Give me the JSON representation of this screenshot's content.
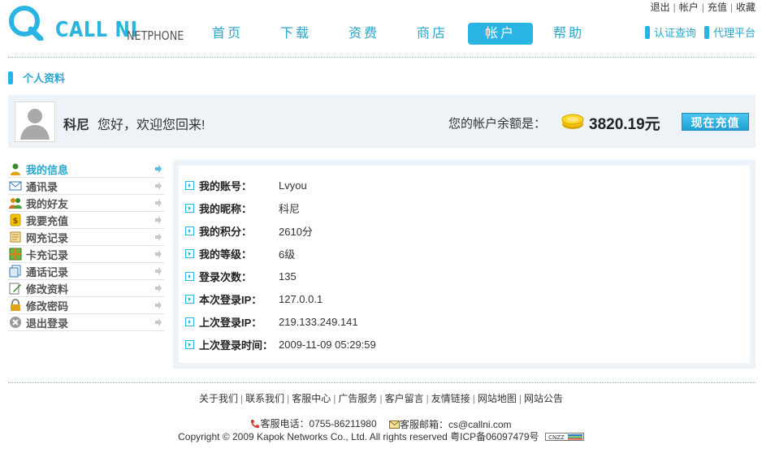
{
  "brand": {
    "logo_text": "CALL NI",
    "logo_sub": "NETPHONE",
    "color_accent": "#2ab4e4"
  },
  "top_links": [
    "退出",
    "帐户",
    "充值",
    "收藏"
  ],
  "nav": [
    {
      "label": "首页",
      "active": false
    },
    {
      "label": "下载",
      "active": false
    },
    {
      "label": "资费",
      "active": false
    },
    {
      "label": "商店",
      "active": false
    },
    {
      "label": "帐户",
      "active": true
    },
    {
      "label": "帮助",
      "active": false
    }
  ],
  "sub_links": [
    "认证查询",
    "代理平台"
  ],
  "section_title": "个人资料",
  "welcome": {
    "name": "科尼",
    "greeting": "您好，欢迎您回来!",
    "balance_label": "您的帐户余额是：",
    "balance_value": "3820.19元",
    "recharge_button": "现在充值"
  },
  "menu": [
    {
      "label": "我的信息",
      "icon": "user-icon",
      "active": true
    },
    {
      "label": "通讯录",
      "icon": "envelope-icon",
      "active": false
    },
    {
      "label": "我的好友",
      "icon": "friends-icon",
      "active": false
    },
    {
      "label": "我要充值",
      "icon": "coin-icon",
      "active": false
    },
    {
      "label": "网充记录",
      "icon": "notebook-icon",
      "active": false
    },
    {
      "label": "卡充记录",
      "icon": "card-icon",
      "active": false
    },
    {
      "label": "通话记录",
      "icon": "pages-icon",
      "active": false
    },
    {
      "label": "修改资料",
      "icon": "edit-icon",
      "active": false
    },
    {
      "label": "修改密码",
      "icon": "lock-icon",
      "active": false
    },
    {
      "label": "退出登录",
      "icon": "exit-icon",
      "active": false
    }
  ],
  "info": [
    {
      "label": "我的账号：",
      "value": "Lvyou"
    },
    {
      "label": "我的昵称：",
      "value": "科尼"
    },
    {
      "label": "我的积分：",
      "value": "2610分"
    },
    {
      "label": "我的等级：",
      "value": "6级"
    },
    {
      "label": "登录次数：",
      "value": "135"
    },
    {
      "label": "本次登录IP：",
      "value": "127.0.0.1"
    },
    {
      "label": "上次登录IP：",
      "value": "219.133.249.141"
    },
    {
      "label": "上次登录时间：",
      "value": "2009-11-09 05:29:59"
    }
  ],
  "footer": {
    "links": [
      "关于我们",
      "联系我们",
      "客服中心",
      "广告服务",
      "客户留言",
      "友情链接",
      "网站地图",
      "网站公告"
    ],
    "phone": "客服电话：0755-86211980",
    "email": "客服邮箱：cs@callni.com",
    "copyright": "Copyright © 2009 Kapok Networks Co., Ltd. All rights reserved 粤ICP备06097479号",
    "badge_text": "CNZZ"
  }
}
